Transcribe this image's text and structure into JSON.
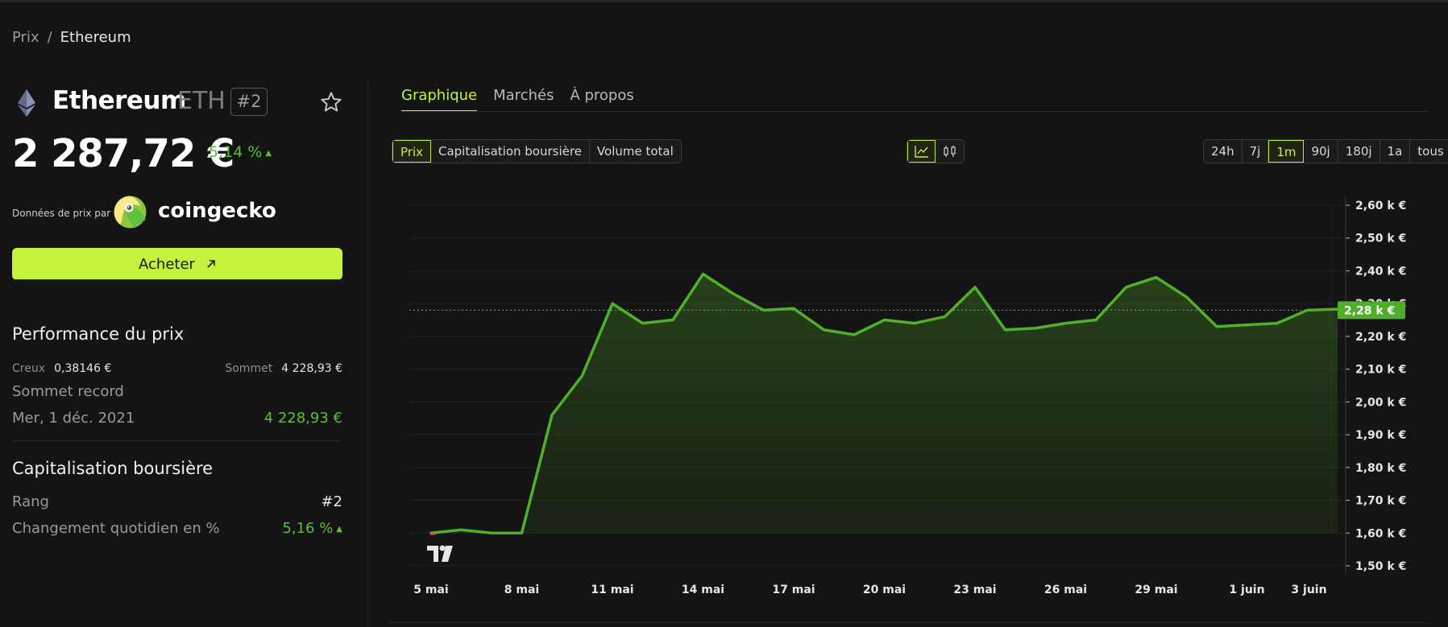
{
  "breadcrumb": {
    "root": "Prix",
    "separator": "/",
    "current": "Ethereum"
  },
  "coin": {
    "name": "Ethereum",
    "symbol": "ETH",
    "rank": "#2",
    "price": "2 287,72 €",
    "change_24h": "5,14 %",
    "price_source_label": "Données de prix par",
    "price_source_name": "coingecko"
  },
  "buy_button": {
    "label": "Acheter"
  },
  "performance": {
    "title": "Performance du prix",
    "low_label": "Creux",
    "low_value": "0,38146 €",
    "high_label": "Sommet",
    "high_value": "4 228,93 €",
    "ath_label": "Sommet record",
    "ath_date": "Mer, 1 déc. 2021",
    "ath_value": "4 228,93 €"
  },
  "market_cap": {
    "title": "Capitalisation boursière",
    "rank_label": "Rang",
    "rank_value": "#2",
    "daily_change_label": "Changement quotidien en %",
    "daily_change_value": "5,16 %"
  },
  "tabs": [
    {
      "label": "Graphique",
      "active": true
    },
    {
      "label": "Marchés",
      "active": false
    },
    {
      "label": "À propos",
      "active": false
    }
  ],
  "metric_buttons": [
    {
      "label": "Prix",
      "active": true
    },
    {
      "label": "Capitalisation boursière",
      "active": false
    },
    {
      "label": "Volume total",
      "active": false
    }
  ],
  "chart_type_buttons": [
    {
      "icon": "line-chart-icon",
      "active": true
    },
    {
      "icon": "candlestick-icon",
      "active": false
    }
  ],
  "range_buttons": [
    {
      "label": "24h",
      "active": false
    },
    {
      "label": "7j",
      "active": false
    },
    {
      "label": "1m",
      "active": true
    },
    {
      "label": "90j",
      "active": false
    },
    {
      "label": "180j",
      "active": false
    },
    {
      "label": "1a",
      "active": false
    },
    {
      "label": "tous",
      "active": false
    }
  ],
  "colors": {
    "accent": "#c5f23c",
    "line": "#4fb02a",
    "positive": "#58c038",
    "background": "#141414"
  },
  "chart_data": {
    "type": "area",
    "x_tick_labels": [
      "5 mai",
      "8 mai",
      "11 mai",
      "14 mai",
      "17 mai",
      "20 mai",
      "23 mai",
      "26 mai",
      "29 mai",
      "1 juin",
      "3 juin"
    ],
    "y_tick_labels": [
      "2,60 k €",
      "2,50 k €",
      "2,40 k €",
      "2,30 k €",
      "2,20 k €",
      "2,10 k €",
      "2,00 k €",
      "1,90 k €",
      "1,80 k €",
      "1,70 k €",
      "1,60 k €",
      "1,50 k €"
    ],
    "ylim": [
      1.48,
      2.63
    ],
    "y_unit": "k €",
    "x": [
      "5 mai",
      "6 mai",
      "7 mai",
      "8 mai",
      "9 mai",
      "10 mai",
      "11 mai",
      "12 mai",
      "13 mai",
      "14 mai",
      "15 mai",
      "16 mai",
      "17 mai",
      "18 mai",
      "19 mai",
      "20 mai",
      "21 mai",
      "22 mai",
      "23 mai",
      "24 mai",
      "25 mai",
      "26 mai",
      "27 mai",
      "28 mai",
      "29 mai",
      "30 mai",
      "31 mai",
      "1 juin",
      "2 juin",
      "3 juin",
      "4 juin"
    ],
    "values": [
      1.6,
      1.61,
      1.6,
      1.6,
      1.96,
      2.08,
      2.3,
      2.24,
      2.25,
      2.39,
      2.33,
      2.28,
      2.285,
      2.22,
      2.205,
      2.25,
      2.24,
      2.26,
      2.35,
      2.22,
      2.225,
      2.24,
      2.25,
      2.35,
      2.38,
      2.32,
      2.23,
      2.235,
      2.24,
      2.28,
      2.283
    ],
    "current_price_label": "2,28 k €",
    "current_value": 2.28,
    "grid": true
  }
}
